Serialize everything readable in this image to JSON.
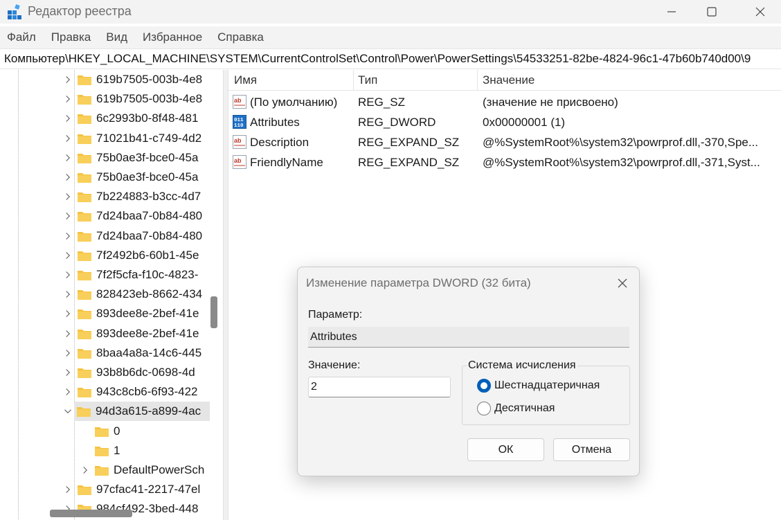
{
  "window": {
    "title": "Редактор реестра"
  },
  "menu": [
    "Файл",
    "Правка",
    "Вид",
    "Избранное",
    "Справка"
  ],
  "address": "Компьютер\\HKEY_LOCAL_MACHINE\\SYSTEM\\CurrentControlSet\\Control\\Power\\PowerSettings\\54533251-82be-4824-96c1-47b60b740d00\\9",
  "tree": [
    {
      "label": "619b7505-003b-4e8",
      "level": 1,
      "expand": "collapsed"
    },
    {
      "label": "619b7505-003b-4e8",
      "level": 1,
      "expand": "collapsed"
    },
    {
      "label": "6c2993b0-8f48-481",
      "level": 1,
      "expand": "collapsed"
    },
    {
      "label": "71021b41-c749-4d2",
      "level": 1,
      "expand": "collapsed"
    },
    {
      "label": "75b0ae3f-bce0-45a",
      "level": 1,
      "expand": "collapsed"
    },
    {
      "label": "75b0ae3f-bce0-45a",
      "level": 1,
      "expand": "collapsed"
    },
    {
      "label": "7b224883-b3cc-4d7",
      "level": 1,
      "expand": "collapsed"
    },
    {
      "label": "7d24baa7-0b84-480",
      "level": 1,
      "expand": "collapsed"
    },
    {
      "label": "7d24baa7-0b84-480",
      "level": 1,
      "expand": "collapsed"
    },
    {
      "label": "7f2492b6-60b1-45e",
      "level": 1,
      "expand": "collapsed"
    },
    {
      "label": "7f2f5cfa-f10c-4823-",
      "level": 1,
      "expand": "collapsed"
    },
    {
      "label": "828423eb-8662-434",
      "level": 1,
      "expand": "collapsed"
    },
    {
      "label": "893dee8e-2bef-41e",
      "level": 1,
      "expand": "collapsed"
    },
    {
      "label": "893dee8e-2bef-41e",
      "level": 1,
      "expand": "collapsed"
    },
    {
      "label": "8baa4a8a-14c6-445",
      "level": 1,
      "expand": "collapsed"
    },
    {
      "label": "93b8b6dc-0698-4d",
      "level": 1,
      "expand": "collapsed"
    },
    {
      "label": "943c8cb6-6f93-422",
      "level": 1,
      "expand": "collapsed"
    },
    {
      "label": "94d3a615-a899-4ac",
      "level": 1,
      "expand": "expanded",
      "selected": true
    },
    {
      "label": "0",
      "level": 2,
      "expand": "none"
    },
    {
      "label": "1",
      "level": 2,
      "expand": "none"
    },
    {
      "label": "DefaultPowerSch",
      "level": 2,
      "expand": "collapsed"
    },
    {
      "label": "97cfac41-2217-47el",
      "level": 1,
      "expand": "collapsed"
    },
    {
      "label": "984cf492-3bed-448",
      "level": 1,
      "expand": "collapsed"
    }
  ],
  "columns": [
    "Имя",
    "Тип",
    "Значение"
  ],
  "values": [
    {
      "icon": "string-value-icon",
      "name": "(По умолчанию)",
      "type": "REG_SZ",
      "data": "(значение не присвоено)"
    },
    {
      "icon": "binary-value-icon",
      "name": "Attributes",
      "type": "REG_DWORD",
      "data": "0x00000001 (1)"
    },
    {
      "icon": "string-value-icon",
      "name": "Description",
      "type": "REG_EXPAND_SZ",
      "data": "@%SystemRoot%\\system32\\powrprof.dll,-370,Spe..."
    },
    {
      "icon": "string-value-icon",
      "name": "FriendlyName",
      "type": "REG_EXPAND_SZ",
      "data": "@%SystemRoot%\\system32\\powrprof.dll,-371,Syst..."
    }
  ],
  "dialog": {
    "title": "Изменение параметра DWORD (32 бита)",
    "param_label": "Параметр:",
    "param_value": "Attributes",
    "value_label": "Значение:",
    "value": "2",
    "base_group": "Система исчисления",
    "hex_label": "Шестнадцатеричная",
    "dec_label": "Десятичная",
    "selected_base": "hex",
    "ok": "ОК",
    "cancel": "Отмена"
  },
  "colors": {
    "accent": "#005fb8",
    "folder": "#f5c342",
    "chrome": "#f3f3f3"
  }
}
